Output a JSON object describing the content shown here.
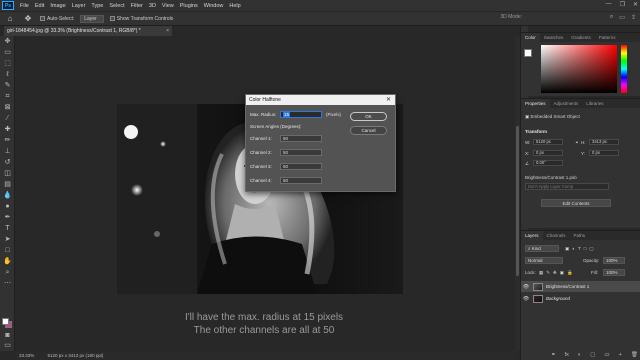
{
  "app": {
    "logo": "Ps"
  },
  "menu": [
    "File",
    "Edit",
    "Image",
    "Layer",
    "Type",
    "Select",
    "Filter",
    "3D",
    "View",
    "Plugins",
    "Window",
    "Help"
  ],
  "window_controls": [
    "—",
    "❐",
    "✕"
  ],
  "options": {
    "auto_select": "Auto-Select:",
    "layer_select": "Layer",
    "show_transform": "Show Transform Controls",
    "mode_3d": "3D Mode:"
  },
  "doc_tab": {
    "title": "girl-1848454.jpg @ 33.3% (Brightness/Contrast 1, RGB/8*) *",
    "close": "×"
  },
  "status": {
    "zoom": "33.33%",
    "size": "5120 px x 3413 px (180 ppi)"
  },
  "dialog": {
    "title": "Color Halftone",
    "close": "✕",
    "max_radius_label": "Max. Radius:",
    "max_radius_value": "15",
    "max_radius_unit": "(Pixels)",
    "screen_angles_label": "Screen Angles (Degrees):",
    "channels": [
      {
        "label": "Channel 1:",
        "value": "50"
      },
      {
        "label": "Channel 2:",
        "value": "50"
      },
      {
        "label": "Channel 3:",
        "value": "50"
      },
      {
        "label": "Channel 4:",
        "value": "50"
      }
    ],
    "ok": "OK",
    "cancel": "Cancel"
  },
  "caption": {
    "line1": "I'll have the max. radius at 15 pixels",
    "line2": "The other channels are all at 50"
  },
  "color_panel": {
    "tabs": [
      "Color",
      "Swatches",
      "Gradients",
      "Patterns"
    ]
  },
  "properties_panel": {
    "tabs": [
      "Properties",
      "Adjustments",
      "Libraries"
    ],
    "object_type": "Embedded Smart Object",
    "transform_label": "Transform",
    "w_label": "W:",
    "w_value": "5120 px",
    "h_label": "H:",
    "h_value": "3413 px",
    "x_label": "X:",
    "x_value": "0 px",
    "y_label": "Y:",
    "y_value": "0 px",
    "angle_value": "0.00°",
    "file_name": "Brightness/Contrast 1.psb",
    "layer_comp": "Don't Apply Layer Comp",
    "edit_contents": "Edit Contents"
  },
  "layers_panel": {
    "tabs": [
      "Layers",
      "Channels",
      "Paths"
    ],
    "kind": "Kind",
    "blend_mode": "Normal",
    "opacity_label": "Opacity:",
    "opacity_value": "100%",
    "lock_label": "Lock:",
    "fill_label": "Fill:",
    "fill_value": "100%",
    "layers": [
      {
        "name": "Brightness/Contrast 1",
        "selected": true
      },
      {
        "name": "Background",
        "selected": false
      }
    ],
    "footer_icons": [
      "fx",
      "◐",
      "▢",
      "▭",
      "+",
      "🗑"
    ]
  }
}
